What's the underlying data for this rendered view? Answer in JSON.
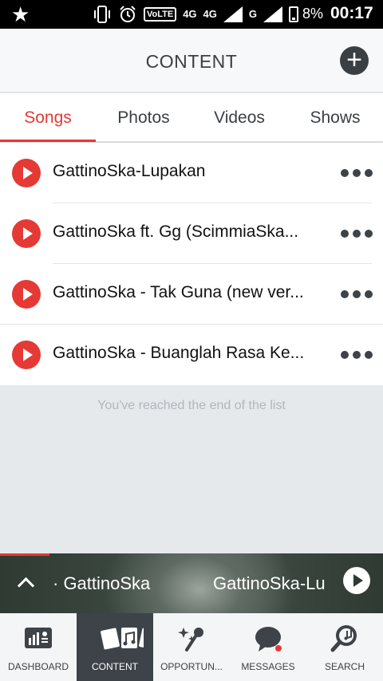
{
  "status_bar": {
    "network_label": "VoLTE",
    "net_type_1": "4G",
    "net_type_1_small": "4G",
    "net_type_2": "G",
    "battery_percent": "8%",
    "time": "00:17"
  },
  "header": {
    "title": "CONTENT",
    "add_icon": "plus-circle-icon"
  },
  "tabs": [
    {
      "label": "Songs",
      "active": true
    },
    {
      "label": "Photos",
      "active": false
    },
    {
      "label": "Videos",
      "active": false
    },
    {
      "label": "Shows",
      "active": false
    }
  ],
  "songs": [
    {
      "title": "GattinoSka-Lupakan"
    },
    {
      "title": "GattinoSka ft. Gg (ScimmiaSka..."
    },
    {
      "title": "GattinoSka - Tak Guna (new ver..."
    },
    {
      "title": "GattinoSka - Buanglah Rasa Ke..."
    }
  ],
  "end_of_list_text": "You've reached the end of the list",
  "player": {
    "artist": "· GattinoSka",
    "track": "GattinoSka-Lu",
    "progress_fraction": 0.13
  },
  "bottom_nav": [
    {
      "label": "DASHBOARD",
      "icon": "dashboard-icon",
      "active": false
    },
    {
      "label": "CONTENT",
      "icon": "content-icon",
      "active": true
    },
    {
      "label": "OPPORTUN...",
      "icon": "opportunities-icon",
      "active": false
    },
    {
      "label": "MESSAGES",
      "icon": "messages-icon",
      "active": false
    },
    {
      "label": "SEARCH",
      "icon": "search-icon",
      "active": false
    }
  ],
  "colors": {
    "accent": "#e53935",
    "dark": "#3d4348"
  }
}
